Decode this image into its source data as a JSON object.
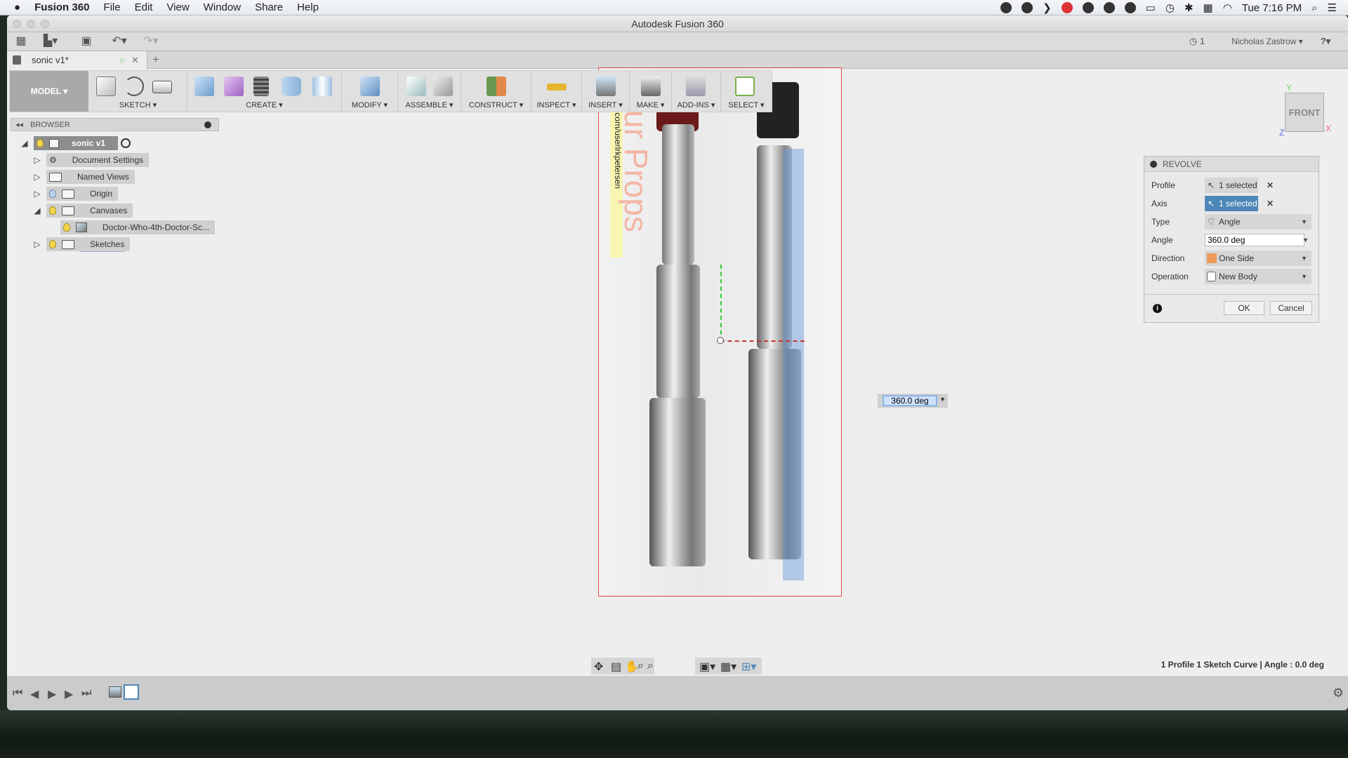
{
  "menubar": {
    "app": "Fusion 360",
    "items": [
      "File",
      "Edit",
      "View",
      "Window",
      "Share",
      "Help"
    ],
    "clock": "Tue 7:16 PM"
  },
  "window": {
    "title": "Autodesk Fusion 360"
  },
  "qat": {
    "jobs_count": "1",
    "user": "Nicholas Zastrow ▾",
    "help": "?"
  },
  "tab": {
    "label": "sonic v1*",
    "new": "+",
    "close": "✕"
  },
  "ribbon": {
    "workspace": "MODEL ▾",
    "groups": [
      "SKETCH ▾",
      "CREATE ▾",
      "MODIFY ▾",
      "ASSEMBLE ▾",
      "CONSTRUCT ▾",
      "INSPECT ▾",
      "INSERT ▾",
      "MAKE ▾",
      "ADD-INS ▾",
      "SELECT ▾"
    ]
  },
  "browser": {
    "title": "BROWSER",
    "root": "sonic v1",
    "items": [
      {
        "label": "Document Settings",
        "icon": "gear-icon"
      },
      {
        "label": "Named Views",
        "icon": "folder-icon"
      },
      {
        "label": "Origin",
        "icon": "folder-icon"
      },
      {
        "label": "Canvases",
        "icon": "folder-icon"
      },
      {
        "label": "Doctor-Who-4th-Doctor-Sc...",
        "icon": "image-icon"
      },
      {
        "label": "Sketches",
        "icon": "folder-icon"
      }
    ]
  },
  "canvas_image": {
    "watermark_url": ".com/userlrkpetersen",
    "watermark_text": "ur Props"
  },
  "viewcube": {
    "face": "FRONT",
    "x": "X",
    "y": "Y",
    "z": "Z"
  },
  "revolve": {
    "title": "REVOLVE",
    "profile_label": "Profile",
    "profile_value": "1 selected",
    "axis_label": "Axis",
    "axis_value": "1 selected",
    "type_label": "Type",
    "type_value": "Angle",
    "angle_label": "Angle",
    "angle_value": "360.0 deg",
    "direction_label": "Direction",
    "direction_value": "One Side",
    "operation_label": "Operation",
    "operation_value": "New Body",
    "ok": "OK",
    "cancel": "Cancel"
  },
  "floating_input": {
    "value": "360.0 deg"
  },
  "status": {
    "text": "1 Profile 1 Sketch Curve | Angle : 0.0 deg"
  },
  "colors": {
    "accent": "#4d87b8",
    "canvas_border": "#e04848"
  }
}
